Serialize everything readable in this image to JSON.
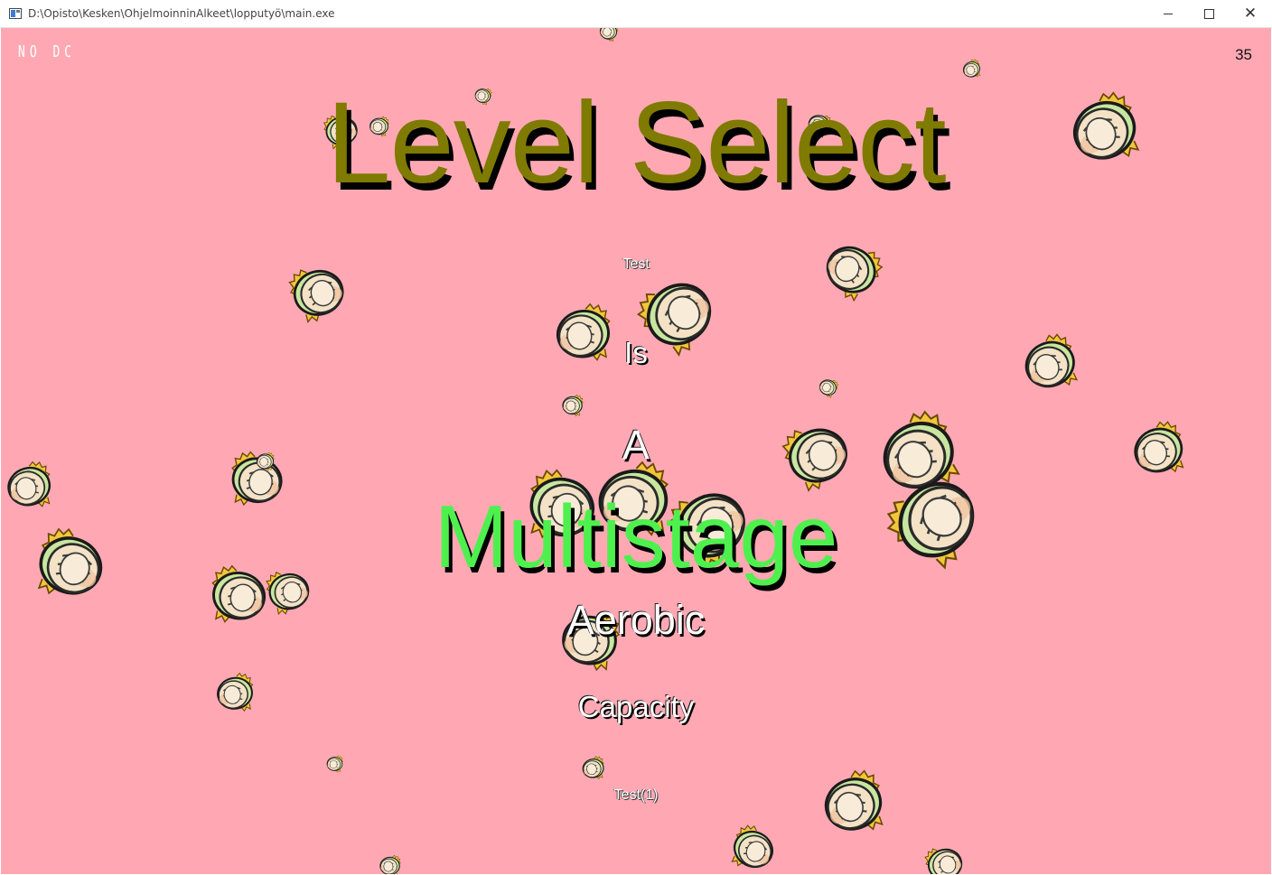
{
  "window": {
    "title": "D:\\Opisto\\Kesken\\OhjelmoinninAlkeet\\lopputyö\\main.exe",
    "controls": {
      "minimize": "—",
      "maximize": "☐",
      "close": "✕"
    }
  },
  "hud": {
    "fps_label": "NO DC",
    "counter": "35"
  },
  "heading": "Level Select",
  "levels": [
    {
      "label": "Test",
      "selected": false
    },
    {
      "label": "Is",
      "selected": false
    },
    {
      "label": "A",
      "selected": false
    },
    {
      "label": "Multistage",
      "selected": true
    },
    {
      "label": "Aerobic",
      "selected": false
    },
    {
      "label": "Capacity",
      "selected": false
    },
    {
      "label": "Test(1)",
      "selected": false
    }
  ],
  "colors": {
    "background": "#ffa8b4",
    "heading": "#7f7a00",
    "selected": "#4ef04e",
    "unselected": "#ffffff"
  },
  "sprites": {
    "icon": "shell-creature-icon"
  }
}
